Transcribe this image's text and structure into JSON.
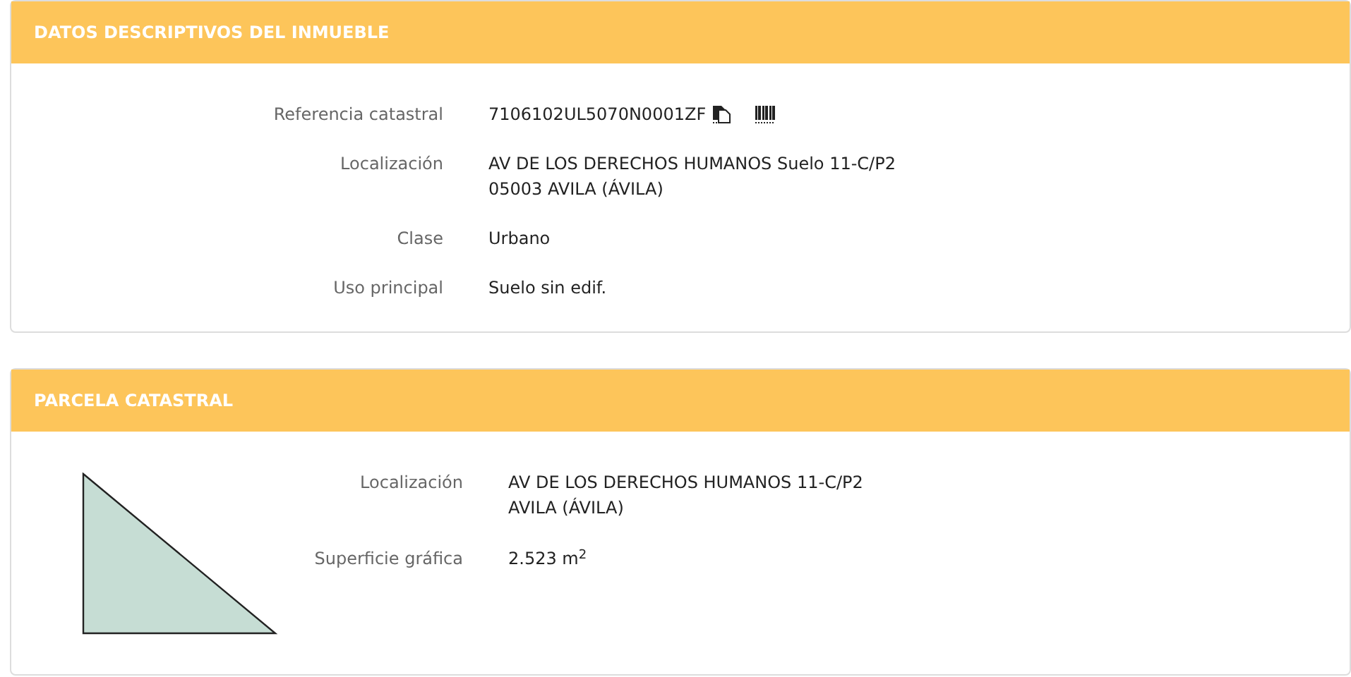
{
  "sections": [
    {
      "title": "DATOS DESCRIPTIVOS DEL INMUEBLE",
      "kind": "details",
      "fields": [
        {
          "label": "Referencia catastral",
          "lines": [
            "7106102UL5070N0001ZF"
          ],
          "kind": "reference"
        },
        {
          "label": "Localización",
          "lines": [
            "AV DE LOS DERECHOS HUMANOS Suelo 11-C/P2",
            "05003 AVILA (ÁVILA)"
          ],
          "kind": "text"
        },
        {
          "label": "Clase",
          "lines": [
            "Urbano"
          ],
          "kind": "text"
        },
        {
          "label": "Uso principal",
          "lines": [
            "Suelo sin edif."
          ],
          "kind": "text"
        }
      ]
    },
    {
      "title": "PARCELA CATASTRAL",
      "kind": "parcel",
      "fields": [
        {
          "label": "Localización",
          "lines": [
            "AV DE LOS DERECHOS HUMANOS 11-C/P2",
            "AVILA (ÁVILA)"
          ],
          "kind": "text"
        },
        {
          "label": "Superficie gráfica",
          "lines": [
            "2.523 m$^{2}$"
          ],
          "kind": "text"
        }
      ]
    }
  ]
}
